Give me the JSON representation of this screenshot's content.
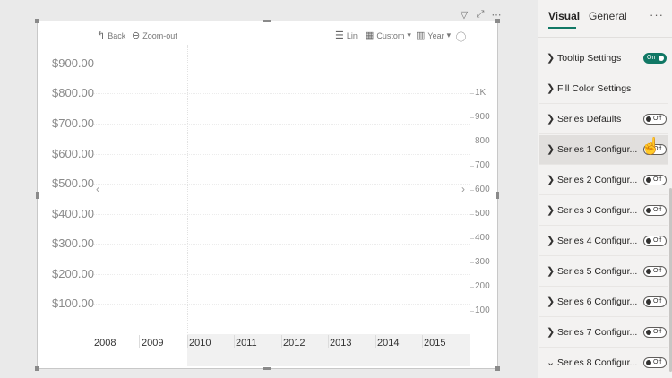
{
  "visual": {
    "header_icons": [
      {
        "name": "filter-icon",
        "glyph": "▽"
      },
      {
        "name": "focus-mode-icon",
        "glyph": "⤢"
      },
      {
        "name": "more-options-icon",
        "glyph": "⋯"
      }
    ],
    "toolbar": {
      "back": "Back",
      "zoom_out": "Zoom-out",
      "lin": "Lin",
      "custom": "Custom",
      "year": "Year"
    },
    "y_left_labels": [
      "$900.00",
      "$800.00",
      "$700.00",
      "$600.00",
      "$500.00",
      "$400.00",
      "$300.00",
      "$200.00",
      "$100.00"
    ],
    "y_right_labels": [
      "1K",
      "900",
      "800",
      "700",
      "600",
      "500",
      "400",
      "300",
      "200",
      "100"
    ],
    "x_labels": [
      "2008",
      "2009",
      "2010",
      "2011",
      "2012",
      "2013",
      "2014",
      "2015"
    ],
    "nav": {
      "left": "‹",
      "right": "›"
    }
  },
  "pane": {
    "tabs": {
      "visual": "Visual",
      "general": "General"
    },
    "more": "···",
    "sections": [
      {
        "label": "Tooltip Settings",
        "toggle": "On",
        "on": true,
        "expanded": false
      },
      {
        "label": "Fill Color Settings",
        "toggle": null,
        "on": false,
        "expanded": false
      },
      {
        "label": "Series Defaults",
        "toggle": "Off",
        "on": false,
        "expanded": false
      },
      {
        "label": "Series 1 Configur...",
        "toggle": "Off",
        "on": false,
        "expanded": false
      },
      {
        "label": "Series 2 Configur...",
        "toggle": "Off",
        "on": false,
        "expanded": false
      },
      {
        "label": "Series 3 Configur...",
        "toggle": "Off",
        "on": false,
        "expanded": false
      },
      {
        "label": "Series 4 Configur...",
        "toggle": "Off",
        "on": false,
        "expanded": false
      },
      {
        "label": "Series 5 Configur...",
        "toggle": "Off",
        "on": false,
        "expanded": false
      },
      {
        "label": "Series 6 Configur...",
        "toggle": "Off",
        "on": false,
        "expanded": false
      },
      {
        "label": "Series 7 Configur...",
        "toggle": "Off",
        "on": false,
        "expanded": false
      },
      {
        "label": "Series 8 Configur...",
        "toggle": "Off",
        "on": false,
        "expanded": true
      }
    ]
  },
  "colors": {
    "accent": "#117865"
  }
}
